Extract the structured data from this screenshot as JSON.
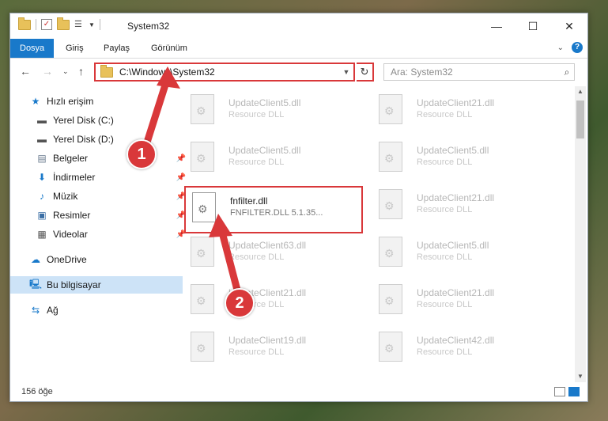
{
  "window": {
    "title": "System32"
  },
  "ribbon": {
    "tabs": [
      "Dosya",
      "Giriş",
      "Paylaş",
      "Görünüm"
    ]
  },
  "nav": {
    "address": "C:\\Windows\\System32",
    "search_placeholder": "Ara: System32"
  },
  "sidebar": {
    "items": [
      {
        "label": "Hızlı erişim",
        "icon": "star-icon"
      },
      {
        "label": "Yerel Disk (C:)",
        "icon": "drive-icon"
      },
      {
        "label": "Yerel Disk (D:)",
        "icon": "drive-icon"
      },
      {
        "label": "Belgeler",
        "icon": "documents-icon"
      },
      {
        "label": "İndirmeler",
        "icon": "download-icon"
      },
      {
        "label": "Müzik",
        "icon": "music-icon"
      },
      {
        "label": "Resimler",
        "icon": "pictures-icon"
      },
      {
        "label": "Videolar",
        "icon": "videos-icon"
      },
      {
        "label": "OneDrive",
        "icon": "cloud-icon"
      },
      {
        "label": "Bu bilgisayar",
        "icon": "computer-icon"
      },
      {
        "label": "Ağ",
        "icon": "network-icon"
      }
    ]
  },
  "files": [
    {
      "name": "UpdateClient5.dll",
      "desc": "Resource DLL"
    },
    {
      "name": "UpdateClient21.dll",
      "desc": "Resource DLL"
    },
    {
      "name": "UpdateClient5.dll",
      "desc": "Resource DLL"
    },
    {
      "name": "UpdateClient5.dll",
      "desc": "Resource DLL"
    },
    {
      "name": "fnfilter.dll",
      "desc": "FNFILTER.DLL 5.1.35..."
    },
    {
      "name": "UpdateClient21.dll",
      "desc": "Resource DLL"
    },
    {
      "name": "UpdateClient63.dll",
      "desc": "Resource DLL"
    },
    {
      "name": "UpdateClient5.dll",
      "desc": "Resource DLL"
    },
    {
      "name": "UpdateClient21.dll",
      "desc": "Resource DLL"
    },
    {
      "name": "UpdateClient21.dll",
      "desc": "Resource DLL"
    },
    {
      "name": "UpdateClient19.dll",
      "desc": "Resource DLL"
    },
    {
      "name": "UpdateClient42.dll",
      "desc": "Resource DLL"
    }
  ],
  "status": {
    "count": "156 öğe"
  },
  "callouts": [
    "1",
    "2"
  ],
  "colors": {
    "accent": "#1979ca",
    "highlight": "#d9383a"
  }
}
